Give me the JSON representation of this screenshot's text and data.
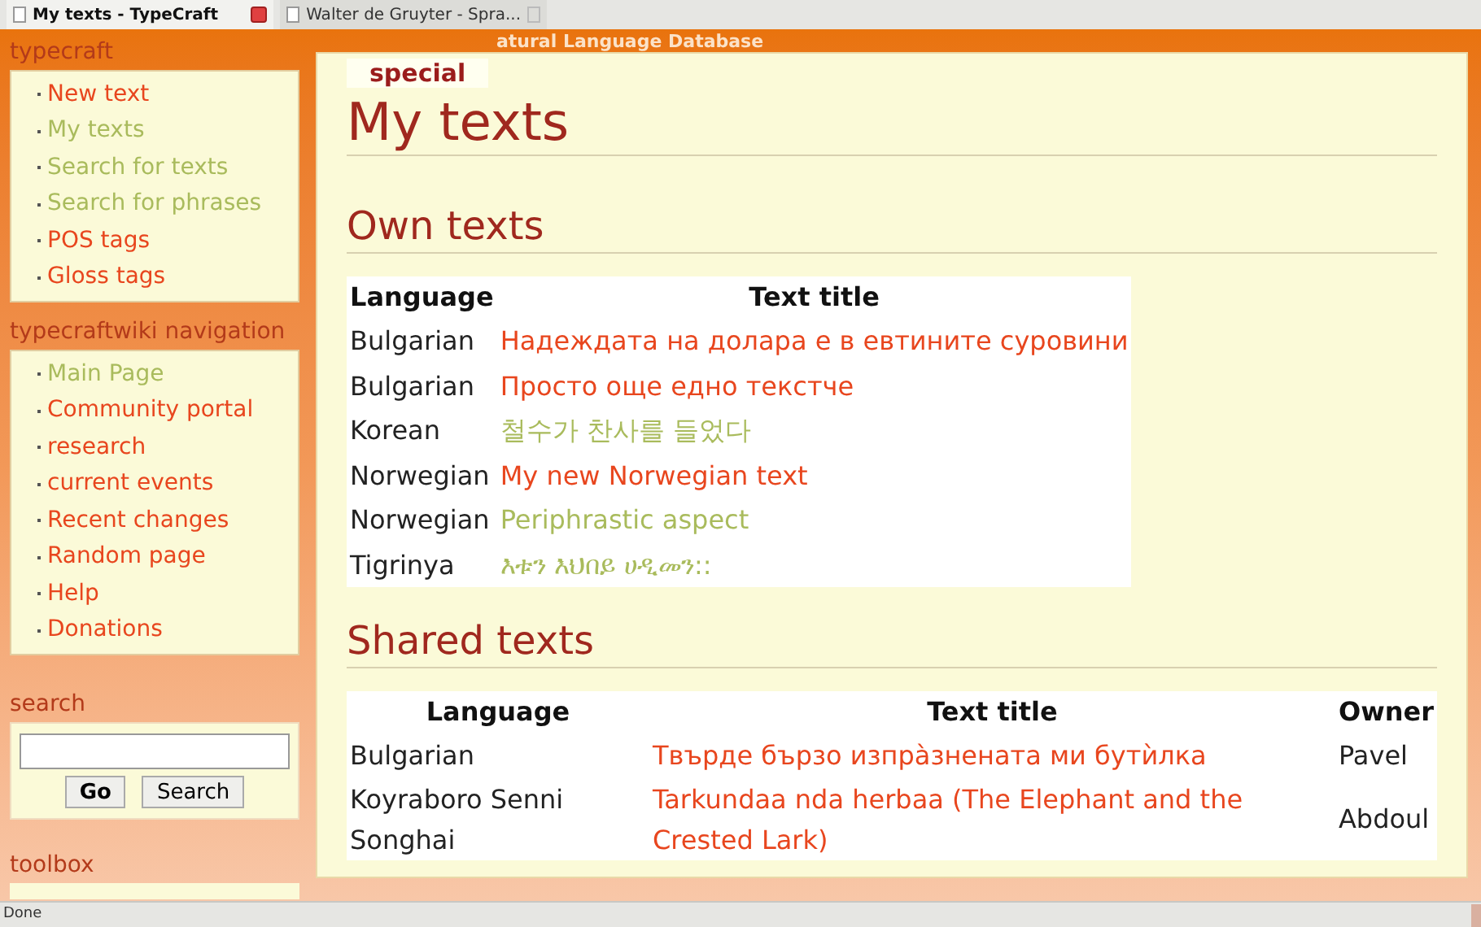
{
  "browser_tabs": [
    {
      "title": "My texts - TypeCraft",
      "selected": true
    },
    {
      "title": "Walter de Gruyter - Spra...",
      "selected": false
    }
  ],
  "sidebar": {
    "portlets": [
      {
        "title": "typecraft",
        "items": [
          {
            "label": "New text",
            "visited": false
          },
          {
            "label": "My texts",
            "visited": true
          },
          {
            "label": "Search for texts",
            "visited": true
          },
          {
            "label": "Search for phrases",
            "visited": true
          },
          {
            "label": "POS tags",
            "visited": false
          },
          {
            "label": "Gloss tags",
            "visited": false
          }
        ]
      },
      {
        "title": "typecraftwiki navigation",
        "items": [
          {
            "label": "Main Page",
            "visited": true
          },
          {
            "label": "Community portal",
            "visited": false
          },
          {
            "label": "research",
            "visited": false
          },
          {
            "label": "current events",
            "visited": false
          },
          {
            "label": "Recent changes",
            "visited": false
          },
          {
            "label": "Random page",
            "visited": false
          },
          {
            "label": "Help",
            "visited": false
          },
          {
            "label": "Donations",
            "visited": false
          }
        ]
      }
    ],
    "search": {
      "title": "search",
      "buttons": [
        "Go",
        "Search"
      ]
    },
    "toolbox": {
      "title": "toolbox"
    }
  },
  "header_text": "atural Language Database",
  "page_tab": {
    "label": "special"
  },
  "title": "My texts",
  "own_texts": {
    "heading": "Own texts",
    "columns": [
      "Language",
      "Text title"
    ],
    "rows": [
      {
        "language": "Bulgarian",
        "title": "Надеждата на долара е в евтините суровини",
        "visited": false
      },
      {
        "language": "Bulgarian",
        "title": "Просто още едно текстче",
        "visited": false
      },
      {
        "language": "Korean",
        "title": "철수가 찬사를 들었다",
        "visited": true
      },
      {
        "language": "Norwegian",
        "title": "My new Norwegian text",
        "visited": false
      },
      {
        "language": "Norwegian",
        "title": "Periphrastic aspect",
        "visited": true
      },
      {
        "language": "Tigrinya",
        "title": "እቱን እህበይ ሀዲመን::",
        "visited": true
      }
    ]
  },
  "shared_texts": {
    "heading": "Shared texts",
    "columns": [
      "Language",
      "Text title",
      "Owner"
    ],
    "rows": [
      {
        "language": "Bulgarian",
        "title": "Твърде бързо изпрàзнената ми бутѝлка",
        "owner": "Pavel",
        "visited": false
      },
      {
        "language": "Koyraboro Senni Songhai",
        "title": "Tarkundaa nda herbaa (The Elephant and the Crested Lark)",
        "owner": "Abdoul",
        "visited": false
      }
    ]
  },
  "status_bar": {
    "text": "Done"
  }
}
